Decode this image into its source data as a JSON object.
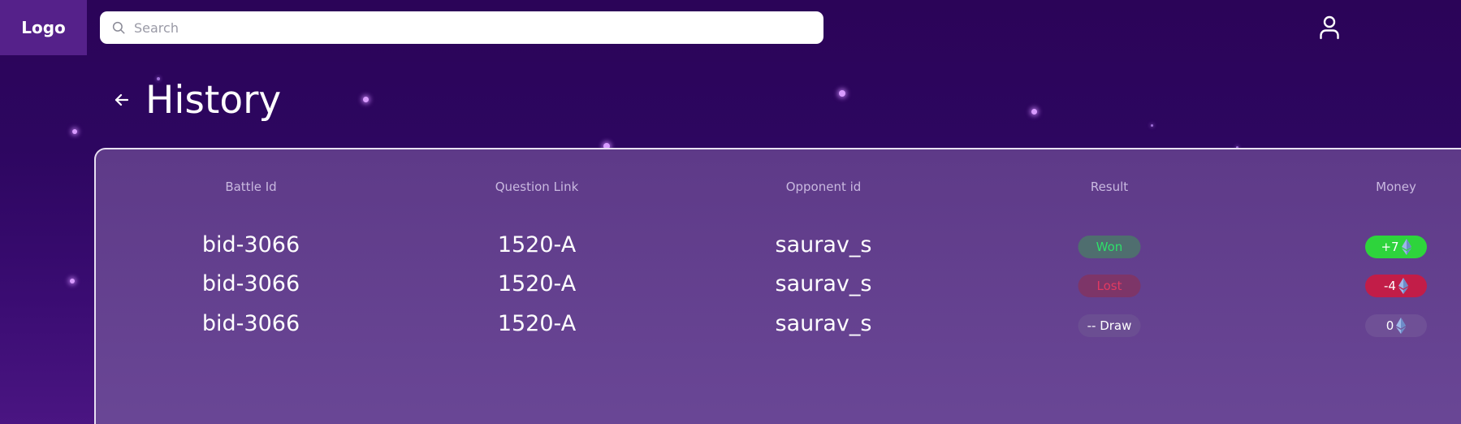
{
  "header": {
    "logo": "Logo",
    "search_placeholder": "Search"
  },
  "page": {
    "title": "History"
  },
  "table": {
    "columns": [
      "Battle Id",
      "Question Link",
      "Opponent id",
      "Result",
      "Money"
    ],
    "rows": [
      {
        "battle_id": "bid-3066",
        "question_link": "1520-A",
        "opponent_id": "saurav_s",
        "result": "Won",
        "money": "+7"
      },
      {
        "battle_id": "bid-3066",
        "question_link": "1520-A",
        "opponent_id": "saurav_s",
        "result": "Lost",
        "money": "-4"
      },
      {
        "battle_id": "bid-3066",
        "question_link": "1520-A",
        "opponent_id": "saurav_s",
        "result": "-- Draw",
        "money": "0"
      }
    ]
  },
  "icons": {
    "search": "search-icon",
    "user": "user-icon",
    "back": "arrow-left-icon",
    "currency": "ethereum-icon"
  },
  "colors": {
    "won": "#2ee06a",
    "lost": "#e03a62",
    "money_positive": "#2ed43c",
    "money_negative": "#c21d48"
  }
}
